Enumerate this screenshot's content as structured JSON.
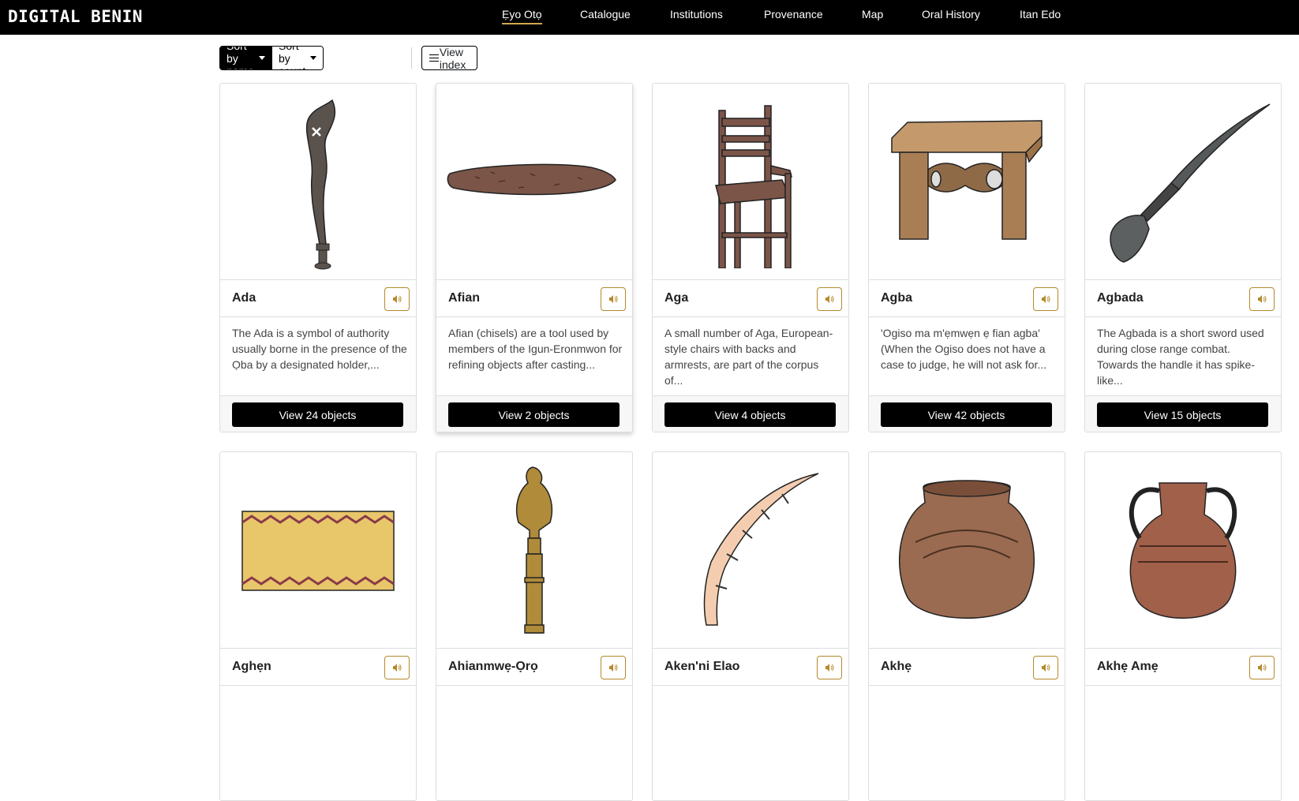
{
  "brand": {
    "logo_text": "DIGITAL BENIN"
  },
  "nav": {
    "items": [
      "Ẹyo Otọ",
      "Catalogue",
      "Institutions",
      "Provenance",
      "Map",
      "Oral History",
      "Itan Edo"
    ],
    "active_index": 0,
    "accent": "#d3a84a"
  },
  "toolbar": {
    "sort_by_name": "Sort by name",
    "sort_by_count": "Sort by count",
    "view_index": "View index"
  },
  "cards": [
    {
      "title": "Ada",
      "description": "The Ada is a symbol of authority usually borne in the presence of the Ọba by a designated holder,...",
      "button": "View 24 objects",
      "icon": "sword-icon"
    },
    {
      "title": "Afian",
      "description": "Afian (chisels) are a tool used by members of the Igun-Eronmwon for refining objects after casting...",
      "button": "View 2 objects",
      "icon": "chisel-icon"
    },
    {
      "title": "Aga",
      "description": "A small number of Aga, European-style chairs with backs and armrests, are part of the corpus of...",
      "button": "View 4 objects",
      "icon": "chair-icon"
    },
    {
      "title": "Agba",
      "description": "'Ogiso ma m'ẹmwẹn ẹ fian agba' (When the Ogiso does not have a case to judge, he will not ask for...",
      "button": "View 42 objects",
      "icon": "stool-icon"
    },
    {
      "title": "Agbada",
      "description": "The Agbada is a short sword used during close range combat. Towards the handle it has spike-like...",
      "button": "View 15 objects",
      "icon": "dagger-icon"
    },
    {
      "title": "Aghẹn",
      "icon": "mat-icon"
    },
    {
      "title": "Ahianmwẹ-Ọrọ",
      "icon": "bird-staff-icon"
    },
    {
      "title": "Aken'ni Elao",
      "icon": "tusk-icon"
    },
    {
      "title": "Akhẹ",
      "icon": "pot-icon"
    },
    {
      "title": "Akhẹ Amẹ",
      "icon": "jar-icon"
    }
  ],
  "colors": {
    "audio_border": "#b5892c",
    "button_bg": "#000000"
  }
}
